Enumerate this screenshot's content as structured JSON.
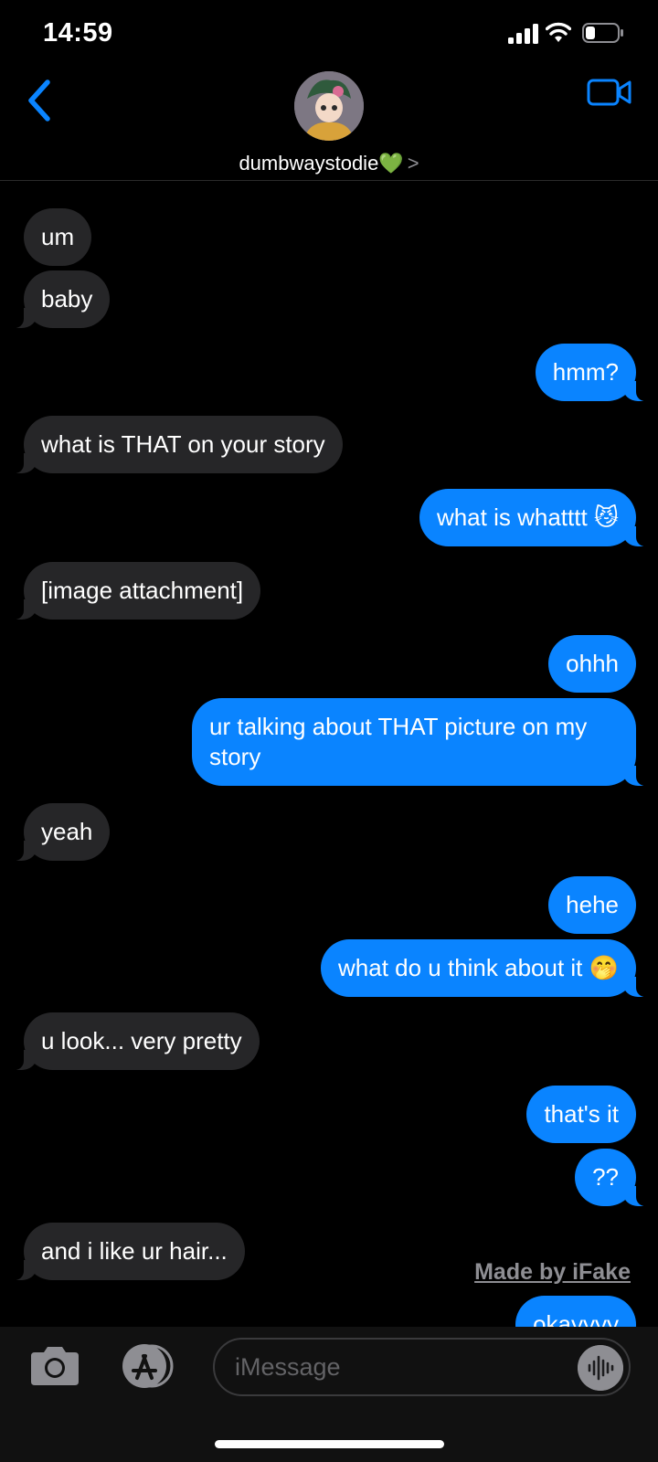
{
  "status": {
    "time": "14:59"
  },
  "header": {
    "contact_name": "dumbwaystodie💚",
    "chevron": ">"
  },
  "messages": [
    {
      "dir": "in",
      "text": "um"
    },
    {
      "dir": "in",
      "text": "baby"
    },
    {
      "dir": "out",
      "text": "hmm?"
    },
    {
      "dir": "in",
      "text": "what is THAT on your story"
    },
    {
      "dir": "out",
      "text": "what is whatttt 😼"
    },
    {
      "dir": "in",
      "text": "[image attachment]"
    },
    {
      "dir": "out",
      "text": "ohhh"
    },
    {
      "dir": "out",
      "text": "ur talking about THAT picture on my story"
    },
    {
      "dir": "in",
      "text": "yeah"
    },
    {
      "dir": "out",
      "text": "hehe"
    },
    {
      "dir": "out",
      "text": "what do u think about it 🤭"
    },
    {
      "dir": "in",
      "text": "u look... very pretty"
    },
    {
      "dir": "out",
      "text": "that's it"
    },
    {
      "dir": "out",
      "text": "??"
    },
    {
      "dir": "in",
      "text": "and i like ur hair..."
    },
    {
      "dir": "out",
      "text": "okayyyy"
    }
  ],
  "watermark": "Made by iFake",
  "input": {
    "placeholder": "iMessage"
  },
  "colors": {
    "accent": "#0a84ff",
    "incoming_bubble": "#262628",
    "background": "#000000"
  },
  "icons": [
    "back-chevron-icon",
    "video-call-icon",
    "camera-icon",
    "app-store-icon",
    "audio-waveform-icon"
  ]
}
